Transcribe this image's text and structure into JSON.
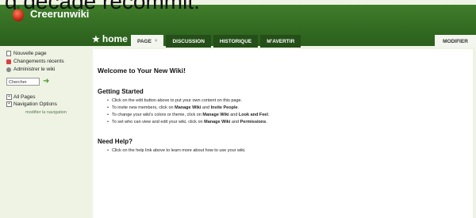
{
  "top_clipped_text": "g decade recommit.",
  "header": {
    "site_title": "Creerunwiki",
    "home_label": "home",
    "tabs": [
      {
        "label": "PAGE",
        "close": "×",
        "active": true
      },
      {
        "label": "DISCUSSION"
      },
      {
        "label": "HISTORIQUE"
      },
      {
        "label": "M'AVERTIR"
      }
    ],
    "modifier_label": "MODIFIER"
  },
  "sidebar": {
    "items": [
      "Nouvelle page",
      "Changements récents",
      "Administrer le wiki"
    ],
    "search_value": "Chercher",
    "search_go": "➜",
    "tree": [
      "All Pages",
      "Navigation Options"
    ],
    "modify_nav": "modifier la navigation"
  },
  "content": {
    "welcome": "Welcome to Your New Wiki!",
    "getting_started": "Getting Started",
    "gs_items": [
      {
        "text": "Click on the edit button above to put your own content on this page."
      },
      {
        "pre": "To invite new members, click on ",
        "b1": "Manage Wiki",
        "mid": " and ",
        "b2": "Invite People",
        "post": "."
      },
      {
        "pre": "To change your wiki's colors or theme, click on ",
        "b1": "Manage Wiki",
        "mid": " and ",
        "b2": "Look and Feel",
        "post": "."
      },
      {
        "pre": "To set who can view and edit your wiki, click on ",
        "b1": "Manage Wiki",
        "mid": " and ",
        "b2": "Permissions",
        "post": "."
      }
    ],
    "need_help": "Need Help?",
    "help_items": [
      "Click on the help link above to learn more about how to use your wiki."
    ]
  }
}
